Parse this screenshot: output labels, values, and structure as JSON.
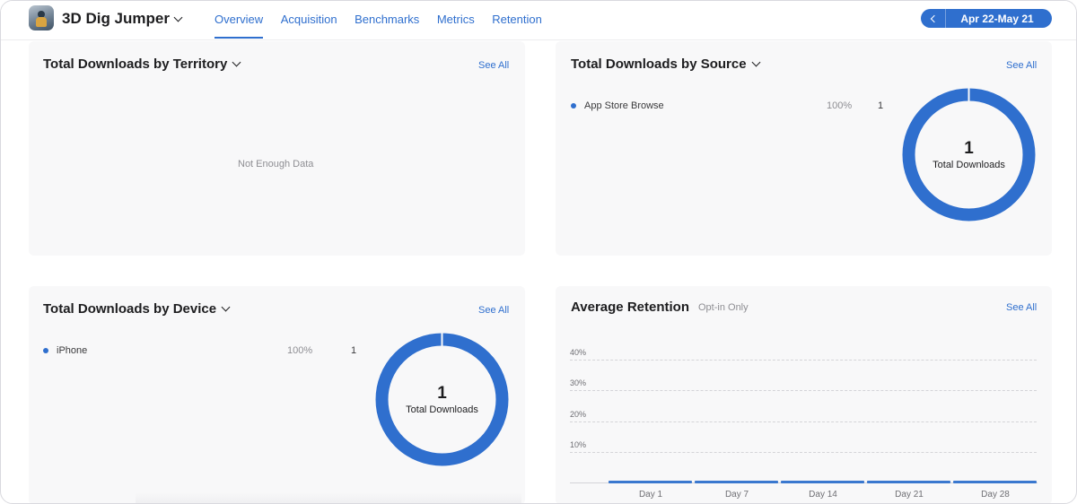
{
  "header": {
    "app_name": "3D Dig Jumper",
    "tabs": [
      "Overview",
      "Acquisition",
      "Benchmarks",
      "Metrics",
      "Retention"
    ],
    "active_tab": "Overview",
    "date_range": "Apr 22-May 21"
  },
  "territory_card": {
    "title": "Total Downloads by Territory",
    "see_all": "See All",
    "empty_text": "Not Enough Data"
  },
  "source_card": {
    "title": "Total Downloads by Source",
    "see_all": "See All",
    "legend": [
      {
        "label": "App Store Browse",
        "percent": "100%",
        "count": "1"
      }
    ],
    "donut_value": "1",
    "donut_label": "Total Downloads"
  },
  "device_card": {
    "title": "Total Downloads by Device",
    "see_all": "See All",
    "legend": [
      {
        "label": "iPhone",
        "percent": "100%",
        "count": "1"
      }
    ],
    "donut_value": "1",
    "donut_label": "Total Downloads"
  },
  "retention_card": {
    "title": "Average Retention",
    "subtitle": "Opt-in Only",
    "see_all": "See All",
    "y_ticks": [
      "40%",
      "30%",
      "20%",
      "10%"
    ],
    "x_ticks": [
      "Day 1",
      "Day 7",
      "Day 14",
      "Day 21",
      "Day 28"
    ]
  },
  "colors": {
    "accent": "#2f6fce",
    "card_bg": "#f8f8f9"
  },
  "chart_data": {
    "type": "bar",
    "categories": [
      "Day 1",
      "Day 7",
      "Day 14",
      "Day 21",
      "Day 28"
    ],
    "values": [
      0,
      0,
      0,
      0,
      0
    ],
    "title": "Average Retention",
    "ylabel": "",
    "xlabel": "",
    "ylim": [
      0,
      40
    ],
    "y_tick_values": [
      10,
      20,
      30,
      40
    ],
    "grid": true
  }
}
